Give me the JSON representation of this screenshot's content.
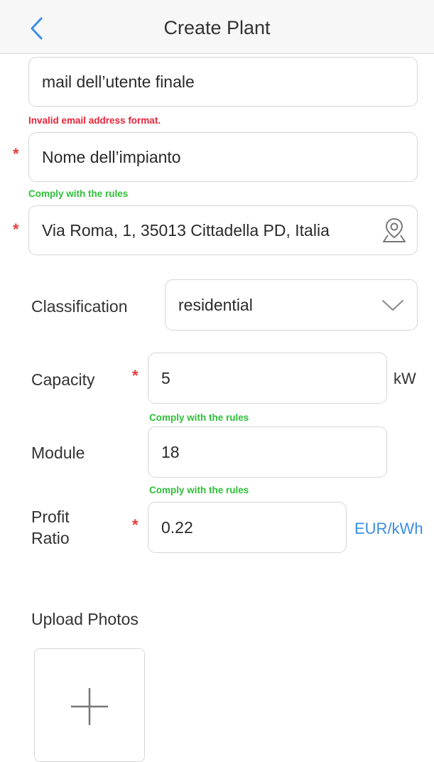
{
  "header": {
    "title": "Create Plant",
    "back_icon": "chevron-left-icon"
  },
  "form": {
    "email": {
      "value": "mail dell’utente finale",
      "message": "Invalid email address format."
    },
    "plant_name": {
      "value": "Nome dell’impianto",
      "message": "Comply with the rules"
    },
    "address": {
      "value": "Via Roma, 1, 35013 Cittadella PD, Italia",
      "icon": "location-pin-icon"
    },
    "classification": {
      "label": "Classification",
      "value": "residential",
      "icon": "chevron-down-icon"
    },
    "capacity": {
      "label": "Capacity",
      "value": "5",
      "unit": "kW",
      "message": "Comply with the rules"
    },
    "module": {
      "label": "Module",
      "value": "18",
      "message": "Comply with the rules"
    },
    "profit_ratio": {
      "label_line1": "Profit",
      "label_line2": "Ratio",
      "value": "0.22",
      "unit": "EUR/kWh"
    },
    "required_mark": "*"
  },
  "upload": {
    "title": "Upload Photos",
    "icon": "plus-icon"
  },
  "colors": {
    "accent": "#3a8ee6",
    "error": "#e8243a",
    "success": "#2fbf3a",
    "required": "#e83a3a",
    "border": "#d6d6d6"
  }
}
